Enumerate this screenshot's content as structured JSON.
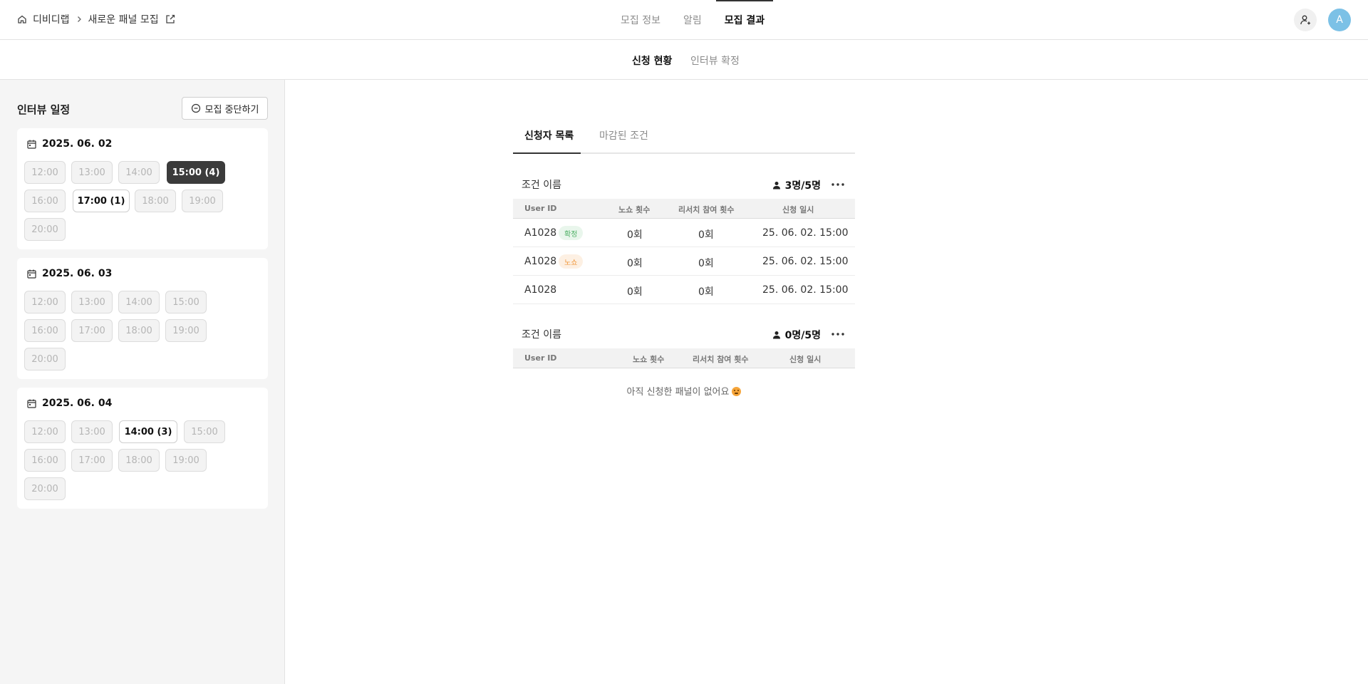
{
  "header": {
    "breadcrumb": [
      "디비디랩",
      "새로운 패널 모집"
    ],
    "tabs": [
      "모집 정보",
      "알림",
      "모집 결과"
    ],
    "active_tab": "모집 결과",
    "avatar_initial": "A"
  },
  "subnav": {
    "tabs": [
      "신청 현황",
      "인터뷰 확정"
    ],
    "active": "신청 현황"
  },
  "sidebar": {
    "title": "인터뷰 일정",
    "stop_button": "모집 중단하기",
    "days": [
      {
        "date": "2025. 06. 02",
        "slots": [
          {
            "label": "12:00",
            "state": "disabled"
          },
          {
            "label": "13:00",
            "state": "disabled"
          },
          {
            "label": "14:00",
            "state": "disabled"
          },
          {
            "label": "15:00 (4)",
            "state": "selected"
          },
          {
            "label": "16:00",
            "state": "disabled"
          },
          {
            "label": "17:00 (1)",
            "state": "open"
          },
          {
            "label": "18:00",
            "state": "disabled"
          },
          {
            "label": "19:00",
            "state": "disabled"
          },
          {
            "label": "20:00",
            "state": "disabled"
          }
        ]
      },
      {
        "date": "2025. 06. 03",
        "slots": [
          {
            "label": "12:00",
            "state": "disabled"
          },
          {
            "label": "13:00",
            "state": "disabled"
          },
          {
            "label": "14:00",
            "state": "disabled"
          },
          {
            "label": "15:00",
            "state": "disabled"
          },
          {
            "label": "16:00",
            "state": "disabled"
          },
          {
            "label": "17:00",
            "state": "disabled"
          },
          {
            "label": "18:00",
            "state": "disabled"
          },
          {
            "label": "19:00",
            "state": "disabled"
          },
          {
            "label": "20:00",
            "state": "disabled"
          }
        ]
      },
      {
        "date": "2025. 06. 04",
        "slots": [
          {
            "label": "12:00",
            "state": "disabled"
          },
          {
            "label": "13:00",
            "state": "disabled"
          },
          {
            "label": "14:00 (3)",
            "state": "open"
          },
          {
            "label": "15:00",
            "state": "disabled"
          },
          {
            "label": "16:00",
            "state": "disabled"
          },
          {
            "label": "17:00",
            "state": "disabled"
          },
          {
            "label": "18:00",
            "state": "disabled"
          },
          {
            "label": "19:00",
            "state": "disabled"
          },
          {
            "label": "20:00",
            "state": "disabled"
          }
        ]
      }
    ]
  },
  "main": {
    "tabs": [
      "신청자 목록",
      "마감된 조건"
    ],
    "active_tab": "신청자 목록",
    "groups": [
      {
        "name": "조건 이름",
        "count": "3명/5명",
        "columns": [
          "User ID",
          "노쇼 횟수",
          "리서치 참여 횟수",
          "신청 일시"
        ],
        "rows": [
          {
            "user_id": "A1028",
            "badge": "확정",
            "badge_color": "#4caf63",
            "noshow": "0회",
            "research": "0회",
            "applied": "25. 06. 02. 15:00"
          },
          {
            "user_id": "A1028",
            "badge": "노쇼",
            "badge_color": "#f0963a",
            "noshow": "0회",
            "research": "0회",
            "applied": "25. 06. 02. 15:00"
          },
          {
            "user_id": "A1028",
            "badge": "",
            "noshow": "0회",
            "research": "0회",
            "applied": "25. 06. 02. 15:00"
          }
        ]
      },
      {
        "name": "조건 이름",
        "count": "0명/5명",
        "columns": [
          "User ID",
          "노쇼 횟수",
          "리서치 참여 횟수",
          "신청 일시"
        ],
        "rows": [],
        "empty_message": "아직 신청한 패널이 없어요"
      }
    ]
  }
}
